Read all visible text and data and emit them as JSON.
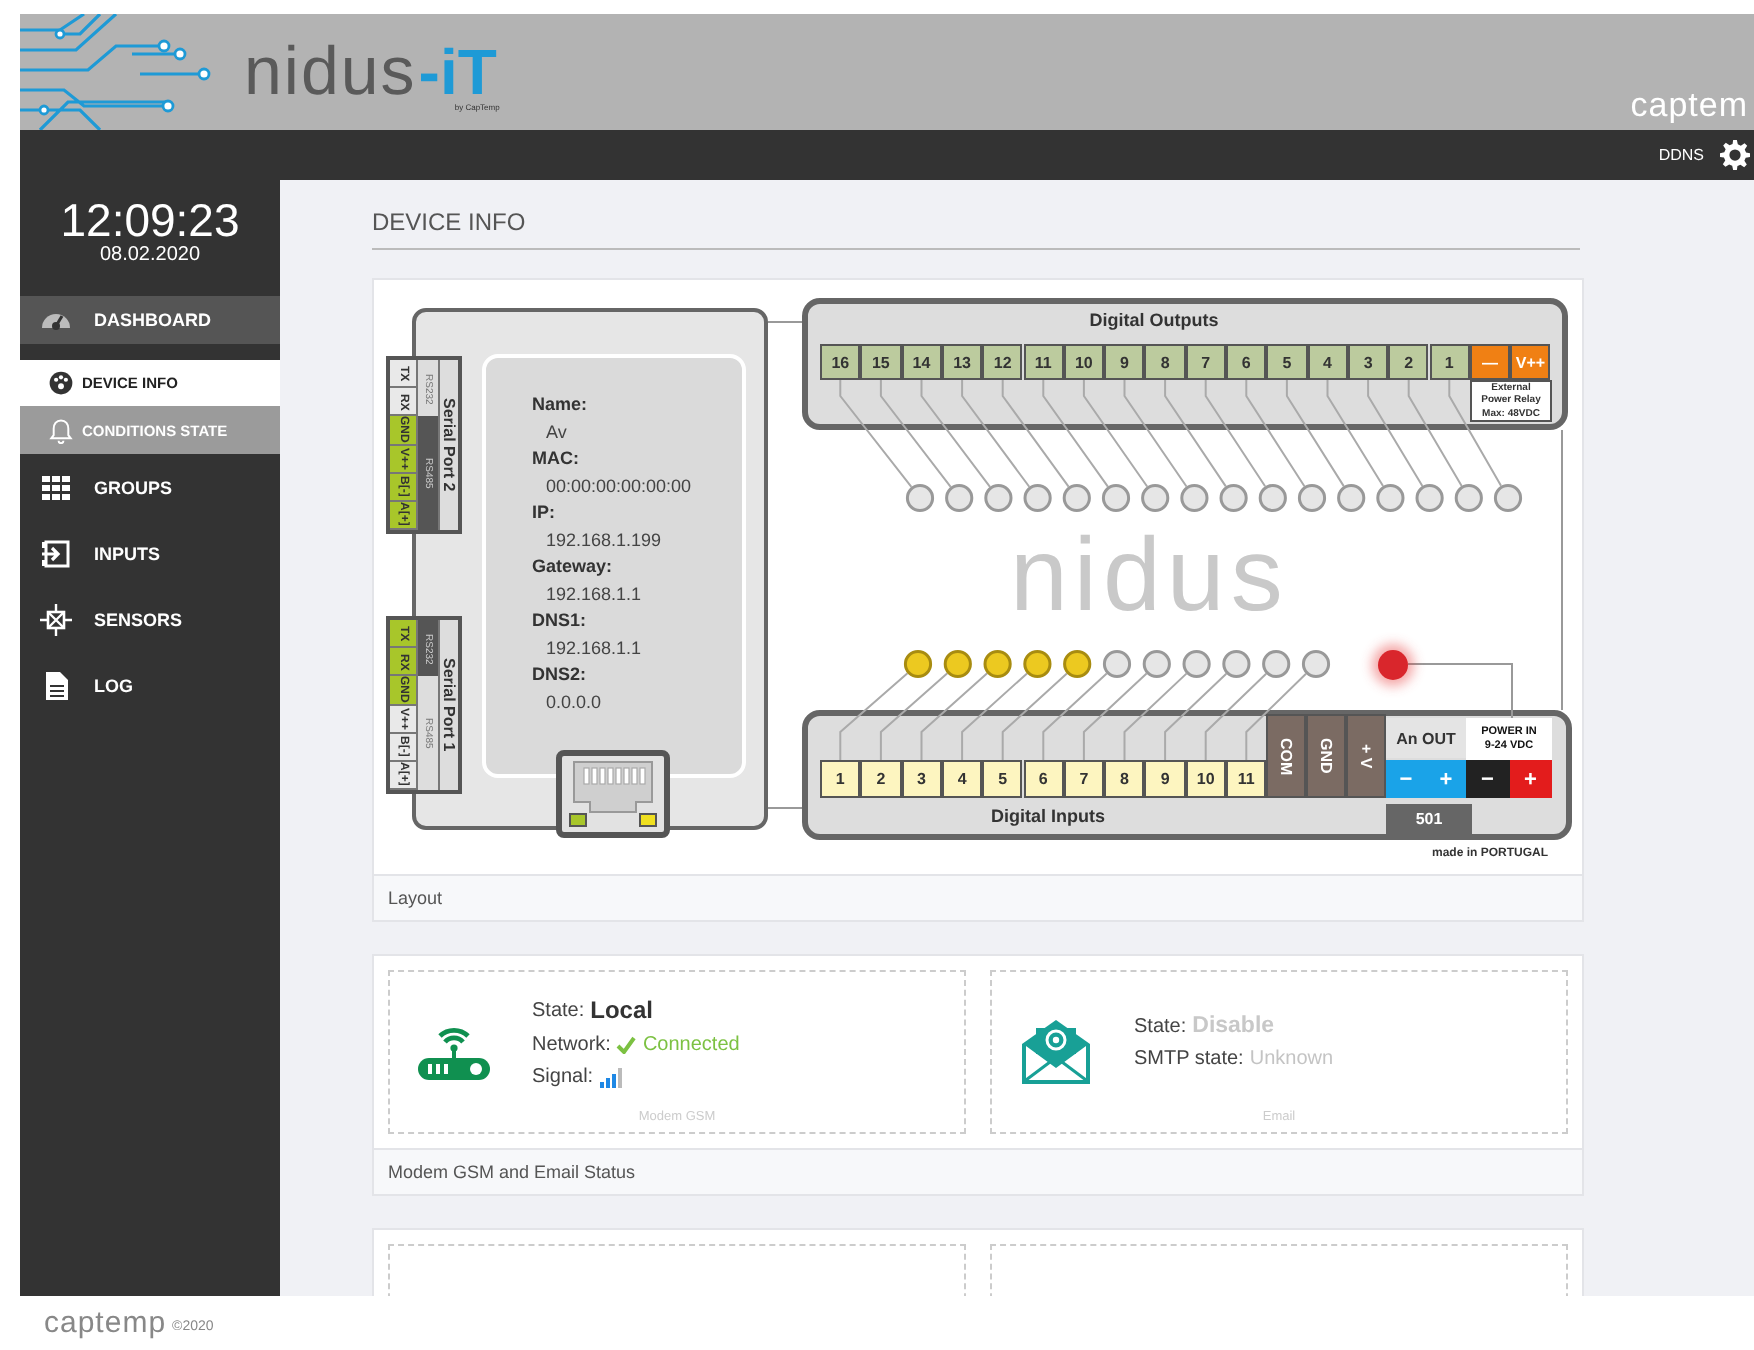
{
  "header": {
    "logo": "nidus",
    "logo_suffix": "-iT",
    "logo_byline": "by CapTemp",
    "brand": "captem"
  },
  "topbar": {
    "link": "DDNS"
  },
  "clock": {
    "time": "12:09:23",
    "date": "08.02.2020"
  },
  "sidebar": {
    "items": [
      {
        "label": "DASHBOARD",
        "selected": true,
        "children": [
          {
            "label": "DEVICE INFO",
            "selected": true
          },
          {
            "label": "CONDITIONS STATE",
            "selected": false
          }
        ]
      },
      {
        "label": "GROUPS",
        "selected": false
      },
      {
        "label": "INPUTS",
        "selected": false
      },
      {
        "label": "SENSORS",
        "selected": false
      },
      {
        "label": "LOG",
        "selected": false
      }
    ]
  },
  "page_title": "DEVICE INFO",
  "layout_card": {
    "footer": "Layout",
    "device": {
      "info": [
        {
          "label": "Name:",
          "value": "Av"
        },
        {
          "label": "MAC:",
          "value": "00:00:00:00:00:00"
        },
        {
          "label": "IP:",
          "value": "192.168.1.199"
        },
        {
          "label": "Gateway:",
          "value": "192.168.1.1"
        },
        {
          "label": "DNS1:",
          "value": "192.168.1.1"
        },
        {
          "label": "DNS2:",
          "value": "0.0.0.0"
        }
      ],
      "serial_ports": [
        {
          "title": "Serial Port 2",
          "pins": [
            {
              "label": "TX",
              "active": false
            },
            {
              "label": "RX",
              "active": false
            },
            {
              "label": "GND",
              "active": true
            },
            {
              "label": "V++",
              "active": true
            },
            {
              "label": "B[-]",
              "active": true
            },
            {
              "label": "A[+]",
              "active": true
            }
          ],
          "modes": [
            {
              "label": "RS232",
              "selected": false
            },
            {
              "label": "RS485",
              "selected": true
            }
          ]
        },
        {
          "title": "Serial Port 1",
          "pins": [
            {
              "label": "TX",
              "active": true
            },
            {
              "label": "RX",
              "active": true
            },
            {
              "label": "GND",
              "active": true
            },
            {
              "label": "V++",
              "active": false
            },
            {
              "label": "B[-]",
              "active": false
            },
            {
              "label": "A[+]",
              "active": false
            }
          ],
          "modes": [
            {
              "label": "RS232",
              "selected": true
            },
            {
              "label": "RS485",
              "selected": false
            }
          ]
        }
      ],
      "outputs_title": "Digital Outputs",
      "outputs": [
        {
          "label": "16",
          "on": false
        },
        {
          "label": "15",
          "on": false
        },
        {
          "label": "14",
          "on": false
        },
        {
          "label": "13",
          "on": false
        },
        {
          "label": "12",
          "on": false
        },
        {
          "label": "11",
          "on": false
        },
        {
          "label": "10",
          "on": false
        },
        {
          "label": "9",
          "on": false
        },
        {
          "label": "8",
          "on": false
        },
        {
          "label": "7",
          "on": false
        },
        {
          "label": "6",
          "on": false
        },
        {
          "label": "5",
          "on": false
        },
        {
          "label": "4",
          "on": false
        },
        {
          "label": "3",
          "on": false
        },
        {
          "label": "2",
          "on": false
        },
        {
          "label": "1",
          "on": false
        }
      ],
      "relay": {
        "minus": "—",
        "plus": "V++",
        "note": "External\nPower Relay\nMax: 48VDC"
      },
      "logo": "nidus",
      "inputs_title": "Digital Inputs",
      "inputs": [
        {
          "label": "1",
          "on": true
        },
        {
          "label": "2",
          "on": true
        },
        {
          "label": "3",
          "on": true
        },
        {
          "label": "4",
          "on": true
        },
        {
          "label": "5",
          "on": true
        },
        {
          "label": "6",
          "on": false
        },
        {
          "label": "7",
          "on": false
        },
        {
          "label": "8",
          "on": false
        },
        {
          "label": "9",
          "on": false
        },
        {
          "label": "10",
          "on": false
        },
        {
          "label": "11",
          "on": false
        }
      ],
      "common": [
        "COM",
        "GND",
        "+ V"
      ],
      "analog_out": {
        "label": "An OUT",
        "minus": "−",
        "plus": "+",
        "value": "501"
      },
      "power": {
        "label": "POWER IN\n9-24 VDC",
        "minus": "−",
        "plus": "+",
        "on": true
      },
      "made_in": "made in PORTUGAL"
    }
  },
  "status_card": {
    "footer": "Modem GSM and Email Status",
    "modem": {
      "caption": "Modem GSM",
      "lines": [
        {
          "kind": "bold",
          "label": "State:",
          "value": "Local"
        },
        {
          "kind": "ok",
          "label": "Network:",
          "value": "Connected"
        },
        {
          "kind": "signal",
          "label": "Signal:"
        }
      ]
    },
    "email": {
      "caption": "Email",
      "lines": [
        {
          "kind": "dimbold",
          "label": "State:",
          "value": "Disable"
        },
        {
          "kind": "dim",
          "label": "SMTP state:",
          "value": "Unknown"
        }
      ]
    }
  },
  "footer": {
    "brand": "captemp",
    "copyright": "©2020"
  }
}
